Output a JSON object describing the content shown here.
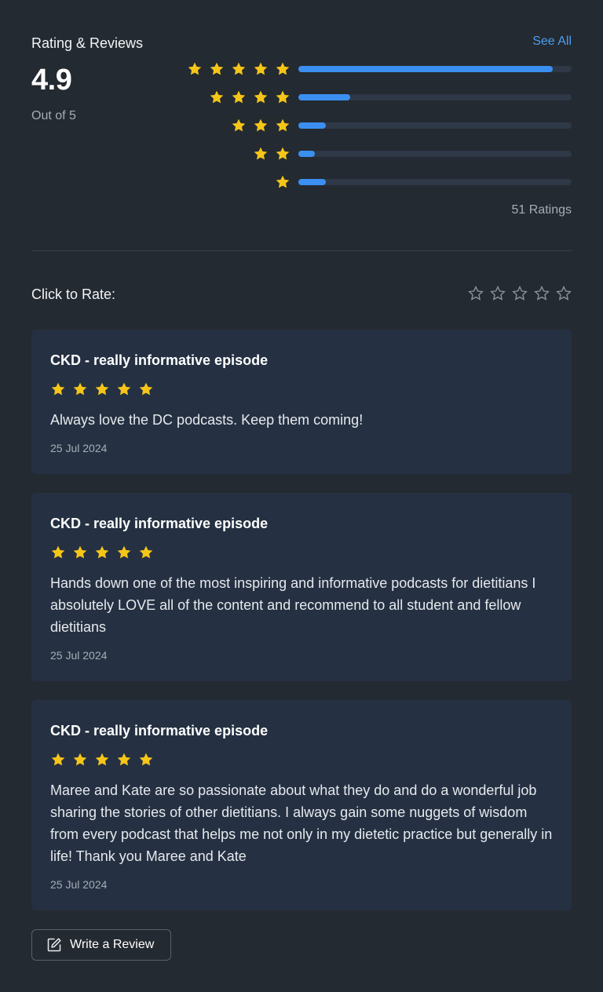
{
  "header": {
    "title": "Rating & Reviews",
    "see_all": "See All"
  },
  "summary": {
    "score": "4.9",
    "out_of": "Out of 5",
    "ratings_count": "51 Ratings",
    "distribution": [
      {
        "stars": 5,
        "fraction": 0.93
      },
      {
        "stars": 4,
        "fraction": 0.19
      },
      {
        "stars": 3,
        "fraction": 0.1
      },
      {
        "stars": 2,
        "fraction": 0.06
      },
      {
        "stars": 1,
        "fraction": 0.1
      }
    ]
  },
  "rate": {
    "label": "Click to Rate:",
    "max_stars": 5
  },
  "reviews": [
    {
      "title": "CKD - really informative episode",
      "stars": 5,
      "body": "Always love the DC podcasts. Keep them coming!",
      "date": "25 Jul 2024"
    },
    {
      "title": "CKD - really informative episode",
      "stars": 5,
      "body": "Hands down one of the most inspiring and informative podcasts for dietitians I absolutely LOVE all of the content and recommend to all student and fellow dietitians",
      "date": "25 Jul 2024"
    },
    {
      "title": "CKD - really informative episode",
      "stars": 5,
      "body": "Maree and Kate are so passionate about what they do and do a wonderful job sharing the stories of other dietitians. I always gain some nuggets of wisdom from every podcast that helps me not only in my dietetic practice but generally in life! Thank you Maree and Kate",
      "date": "25 Jul 2024"
    }
  ],
  "actions": {
    "write_review": "Write a Review"
  },
  "colors": {
    "background": "#242a31",
    "card": "#253142",
    "accent": "#4a9ff0",
    "bar": "#3b8ff0",
    "star": "#f5c518"
  },
  "icons": {
    "star_filled": "star-icon",
    "star_outline": "star-outline-icon",
    "edit": "edit-icon"
  }
}
